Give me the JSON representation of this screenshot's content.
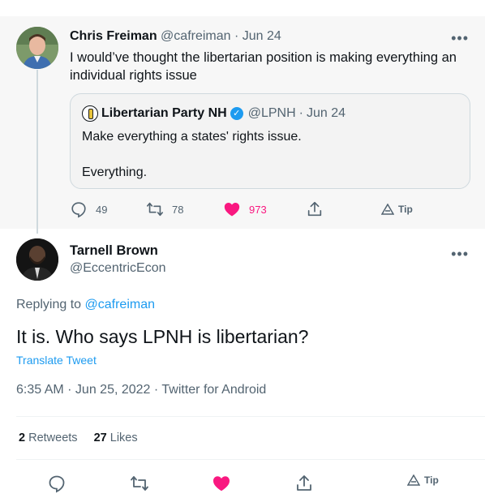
{
  "parent_tweet": {
    "display_name": "Chris Freiman",
    "handle": "@cafreiman",
    "date": "Jun 24",
    "text": "I would’ve thought the libertarian position is making everything an individual rights issue",
    "quoted": {
      "display_name": "Libertarian Party NH",
      "handle": "@LPNH",
      "date": "Jun 24",
      "line1": "Make everything a states' rights issue.",
      "line2": "Everything."
    },
    "replies": "49",
    "retweets": "78",
    "likes": "973",
    "tip_label": "Tip"
  },
  "main_tweet": {
    "display_name": "Tarnell Brown",
    "handle": "@EccentricEcon",
    "replying_prefix": "Replying to",
    "replying_to": "@cafreiman",
    "text": "It is. Who says LPNH is libertarian?",
    "translate_label": "Translate Tweet",
    "timestamp": "6:35 AM · Jun 25, 2022 · Twitter for Android",
    "retweet_count": "2",
    "retweet_label": "Retweets",
    "like_count": "27",
    "like_label": "Likes",
    "tip_label": "Tip"
  },
  "icons": {
    "more": "more-icon",
    "reply": "reply-icon",
    "retweet": "retweet-icon",
    "like": "heart-icon",
    "share": "share-icon",
    "tip": "tip-icon",
    "verified": "verified-badge-icon"
  },
  "colors": {
    "accent": "#1d9bf0",
    "like": "#f91880",
    "muted": "#536471",
    "text": "#0f1419"
  }
}
